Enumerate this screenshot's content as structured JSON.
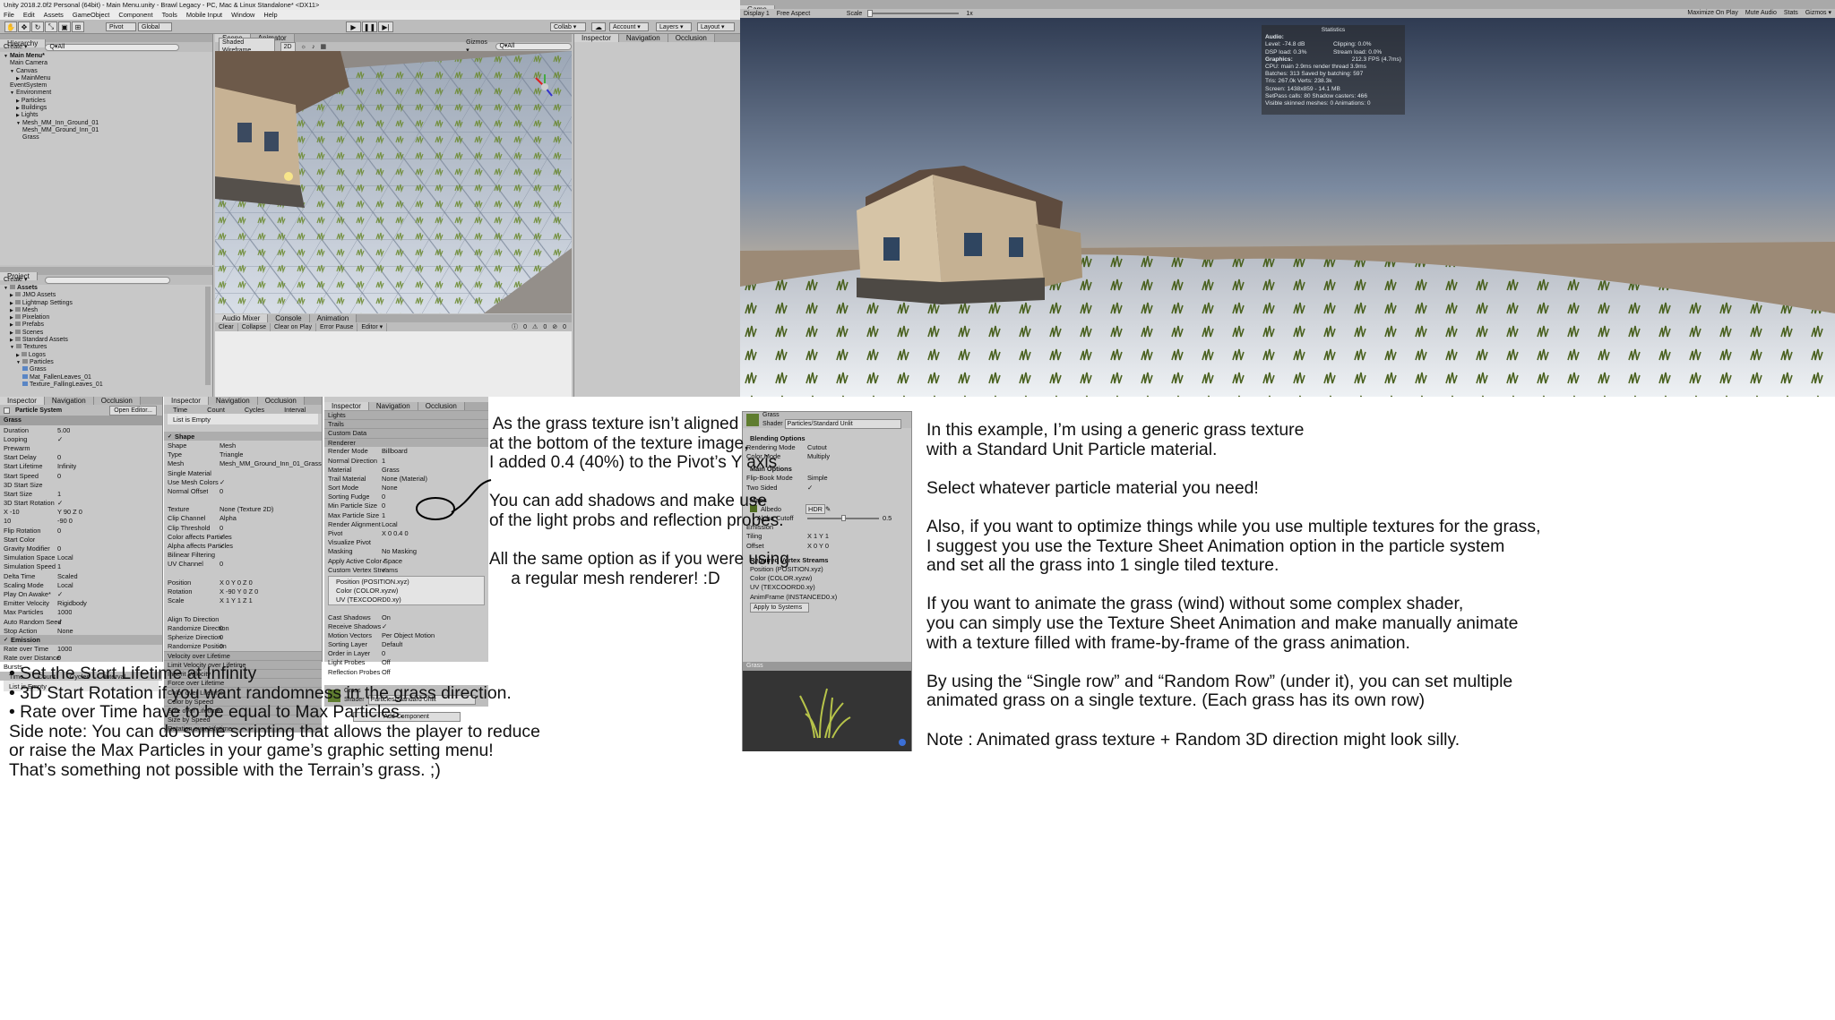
{
  "window": {
    "title": "Unity 2018.2.0f2 Personal (64bit) - Main Menu.unity - Brawl Legacy - PC, Mac & Linux Standalone* <DX11>"
  },
  "menu": [
    "File",
    "Edit",
    "Assets",
    "GameObject",
    "Component",
    "Tools",
    "Mobile Input",
    "Window",
    "Help"
  ],
  "toolbar": {
    "pivot": "Pivot",
    "global": "Global",
    "collab": "Collab ▾",
    "account": "Account ▾",
    "layers": "Layers ▾",
    "layout": "Layout ▾",
    "play_icon": "play-icon",
    "pause_icon": "pause-icon",
    "step_icon": "step-icon"
  },
  "hierarchy": {
    "tab": "Hierarchy",
    "create": "Create ▾",
    "search": "Q▾All",
    "items": [
      "Main Menu*",
      "Main Camera",
      "Canvas",
      "MainMenu",
      "EventSystem",
      "Environment",
      "Particles",
      "Buildings",
      "Lights",
      "Mesh_MM_Inn_Ground_01",
      "Mesh_MM_Ground_Inn_01",
      "Grass"
    ]
  },
  "project": {
    "tab": "Project",
    "create": "Create ▾",
    "items": [
      "Assets",
      "JMO Assets",
      "Lightmap Settings",
      "Mesh",
      "Pixelation",
      "Prefabs",
      "Scenes",
      "Standard Assets",
      "Textures",
      "Logos",
      "Particles",
      "Grass",
      "Mat_FallenLeaves_01",
      "Texture_FallingLeaves_01"
    ]
  },
  "scene": {
    "tabs": [
      "Scene",
      "Animator"
    ],
    "shading": "Shaded Wireframe",
    "mode": "2D",
    "gizmos": "Gizmos ▾",
    "search": "Q▾All"
  },
  "console": {
    "tabs": [
      "Audio Mixer",
      "Console",
      "Animation"
    ],
    "buttons": [
      "Clear",
      "Collapse",
      "Clear on Play",
      "Error Pause",
      "Editor ▾"
    ],
    "counts": [
      "0",
      "0",
      "0"
    ]
  },
  "inspector_top": {
    "tabs": [
      "Inspector",
      "Navigation",
      "Occlusion"
    ]
  },
  "game": {
    "tab": "Game",
    "display": "Display 1",
    "aspect": "Free Aspect",
    "scale_label": "Scale",
    "scale_value": "1x",
    "buttons": [
      "Maximize On Play",
      "Mute Audio",
      "Stats",
      "Gizmos ▾"
    ]
  },
  "stats": {
    "title": "Statistics",
    "audio_label": "Audio:",
    "audio_lines": [
      "Level: -74.8 dB",
      "Clipping: 0.0%",
      "DSP load: 0.3%",
      "Stream load: 0.0%"
    ],
    "graphics_label": "Graphics:",
    "fps": "212.3 FPS (4.7ms)",
    "graphics_lines": [
      "CPU: main 2.9ms  render thread 3.9ms",
      "Batches: 313    Saved by batching: 597",
      "Tris: 267.0k    Verts: 238.3k",
      "Screen: 1438x859 - 14.1 MB",
      "SetPass calls: 80    Shadow casters: 466",
      "Visible skinned meshes: 0  Animations: 0"
    ]
  },
  "ps1": {
    "tabs": [
      "Inspector",
      "Navigation",
      "Occlusion"
    ],
    "title": "Particle System",
    "open_editor": "Open Editor...",
    "name": "Grass",
    "rows": [
      [
        "Duration",
        "5.00"
      ],
      [
        "Looping",
        "✓"
      ],
      [
        "Prewarm",
        ""
      ],
      [
        "Start Delay",
        "0"
      ],
      [
        "Start Lifetime",
        "Infinity"
      ],
      [
        "Start Speed",
        "0"
      ],
      [
        "3D Start Size",
        ""
      ],
      [
        "Start Size",
        "1"
      ],
      [
        "3D Start Rotation",
        "✓"
      ],
      [
        "X -10",
        "Y 90   Z 0"
      ],
      [
        "  10",
        "  -90     0"
      ],
      [
        "Flip Rotation",
        "0"
      ],
      [
        "Start Color",
        ""
      ],
      [
        "Gravity Modifier",
        "0"
      ],
      [
        "Simulation Space",
        "Local"
      ],
      [
        "Simulation Speed",
        "1"
      ],
      [
        "Delta Time",
        "Scaled"
      ],
      [
        "Scaling Mode",
        "Local"
      ],
      [
        "Play On Awake*",
        "✓"
      ],
      [
        "Emitter Velocity",
        "Rigidbody"
      ],
      [
        "Max Particles",
        "1000"
      ],
      [
        "Auto Random Seed",
        "✓"
      ],
      [
        "Stop Action",
        "None"
      ]
    ],
    "emission": "Emission",
    "emission_rows": [
      [
        "Rate over Time",
        "1000"
      ],
      [
        "Rate over Distance",
        "0"
      ]
    ],
    "bursts": "Bursts",
    "burst_cols": [
      "Time",
      "Count",
      "Cycles",
      "Interval"
    ],
    "list_empty": "List is Empty"
  },
  "ps2": {
    "tabs": [
      "Inspector",
      "Navigation",
      "Occlusion"
    ],
    "cols": [
      "Time",
      "Count",
      "Cycles",
      "Interval"
    ],
    "list_empty": "List is Empty",
    "shape": "Shape",
    "rows": [
      [
        "Shape",
        "Mesh"
      ],
      [
        "Type",
        "Triangle"
      ],
      [
        "Mesh",
        "Mesh_MM_Ground_Inn_01_Grass"
      ],
      [
        "Single Material",
        ""
      ],
      [
        "Use Mesh Colors",
        "✓"
      ],
      [
        "Normal Offset",
        "0"
      ],
      [
        "",
        ""
      ],
      [
        "Texture",
        "None (Texture 2D)"
      ],
      [
        "Clip Channel",
        "Alpha"
      ],
      [
        "Clip Threshold",
        "0"
      ],
      [
        "Color affects Particles",
        "✓"
      ],
      [
        "Alpha affects Particles",
        "✓"
      ],
      [
        "Bilinear Filtering",
        ""
      ],
      [
        "UV Channel",
        "0"
      ],
      [
        "",
        ""
      ],
      [
        "Position",
        "X 0   Y 0   Z 0"
      ],
      [
        "Rotation",
        "X -90   Y 0   Z 0"
      ],
      [
        "Scale",
        "X 1   Y 1   Z 1"
      ],
      [
        "",
        ""
      ],
      [
        "Align To Direction",
        ""
      ],
      [
        "Randomize Direction",
        "0"
      ],
      [
        "Spherize Direction",
        "0"
      ],
      [
        "Randomize Position",
        "0"
      ]
    ],
    "modules": [
      "Velocity over Lifetime",
      "Limit Velocity over Lifetime",
      "Inherit Velocity",
      "Force over Lifetime",
      "Color over Lifetime",
      "Color by Speed",
      "Size over Lifetime",
      "Size by Speed",
      "Rotation over Lifetime"
    ]
  },
  "ps3": {
    "tabs": [
      "Inspector",
      "Navigation",
      "Occlusion"
    ],
    "modules": [
      "Lights",
      "Trails",
      "Custom Data",
      "Renderer"
    ],
    "rows": [
      [
        "Render Mode",
        "Billboard"
      ],
      [
        "Normal Direction",
        "1"
      ],
      [
        "Material",
        "Grass"
      ],
      [
        "Trail Material",
        "None (Material)"
      ],
      [
        "Sort Mode",
        "None"
      ],
      [
        "Sorting Fudge",
        "0"
      ],
      [
        "Min Particle Size",
        "0"
      ],
      [
        "Max Particle Size",
        "1"
      ],
      [
        "Render Alignment",
        "Local"
      ],
      [
        "Pivot",
        "X 0      0.4      0"
      ],
      [
        "Visualize Pivot",
        ""
      ],
      [
        "Masking",
        "No Masking"
      ],
      [
        "Apply Active Color Space",
        "✓"
      ],
      [
        "Custom Vertex Streams",
        "✓"
      ]
    ],
    "streams": [
      "Position (POSITION.xyz)",
      "Color (COLOR.xyzw)",
      "UV (TEXCOORD0.xy)"
    ],
    "rows2": [
      [
        "Cast Shadows",
        "On"
      ],
      [
        "Receive Shadows",
        "✓"
      ],
      [
        "Motion Vectors",
        "Per Object Motion"
      ],
      [
        "Sorting Layer",
        "Default"
      ],
      [
        "Order in Layer",
        "0"
      ],
      [
        "Light Probes",
        "Off"
      ],
      [
        "Reflection Probes",
        "Off"
      ]
    ],
    "mat_name": "Grass",
    "shader_label": "Shader",
    "shader": "Particles/Standard Unlit",
    "add_component": "Add Component",
    "pivot_value": "0.4"
  },
  "mat": {
    "name": "Grass",
    "shader_label": "Shader",
    "shader": "Particles/Standard Unlit",
    "blending": "Blending Options",
    "rows1": [
      [
        "Rendering Mode",
        "Cutout"
      ],
      [
        "Color Mode",
        "Multiply"
      ]
    ],
    "main": "Main Options",
    "rows2": [
      [
        "Flip-Book Mode",
        "Simple"
      ],
      [
        "Two Sided",
        "✓"
      ]
    ],
    "maps": "Maps",
    "albedo": "Albedo",
    "hdr": "HDR",
    "cutoff": "Alpha Cutoff",
    "cutoff_value": "0.5",
    "rows3": [
      [
        "Emission",
        ""
      ],
      [
        "Tiling",
        "X 1      Y 1"
      ],
      [
        "Offset",
        "X 0      Y 0"
      ]
    ],
    "streams_title": "Required Vertex Streams",
    "streams": [
      "Position (POSITION.xyz)",
      "Color (COLOR.xyzw)",
      "UV (TEXCOORD0.xy)",
      "AnimFrame (INSTANCED0.x)"
    ],
    "apply": "Apply to Systems",
    "preview": "Grass"
  },
  "notes": {
    "mid": [
      "As the grass texture isn’t aligned",
      "at the bottom of the texture image,",
      "I added 0.4 (40%) to the Pivot’s Y axis",
      "",
      "You can add shadows and make use",
      "of the light probs and reflection probes.",
      "",
      "All the same option as if you were using",
      "a regular mesh renderer! :D"
    ],
    "bottom": [
      "• Set the Start Lifetime at Infinity",
      "• 3D Start Rotation if you want randomness in the grass direction.",
      "• Rate over Time have to be equal to Max Particles.",
      "Side note: You can do some scripting that allows the player to reduce",
      "or raise the Max Particles in your game’s graphic setting menu!",
      "That’s something not possible with the Terrain’s grass. ;)"
    ],
    "right": [
      "In this example, I’m using a generic grass texture",
      "with a Standard Unit Particle material.",
      "",
      "Select whatever particle material you need!",
      "",
      "Also, if you want to optimize things while you use multiple textures for the grass,",
      "I suggest you use the Texture Sheet Animation option in the particle system",
      "and set all the grass into 1 single tiled texture.",
      "",
      "If you want to animate the grass (wind) without some complex shader,",
      "you can simply use the Texture Sheet Animation and make manually animate",
      "with a texture filled with frame-by-frame of the grass animation.",
      "",
      "By using the “Single row” and “Random Row” (under it), you can set multiple",
      "animated grass on a single texture. (Each grass has its own row)",
      "",
      "Note : Animated grass texture + Random 3D direction might look silly."
    ]
  }
}
